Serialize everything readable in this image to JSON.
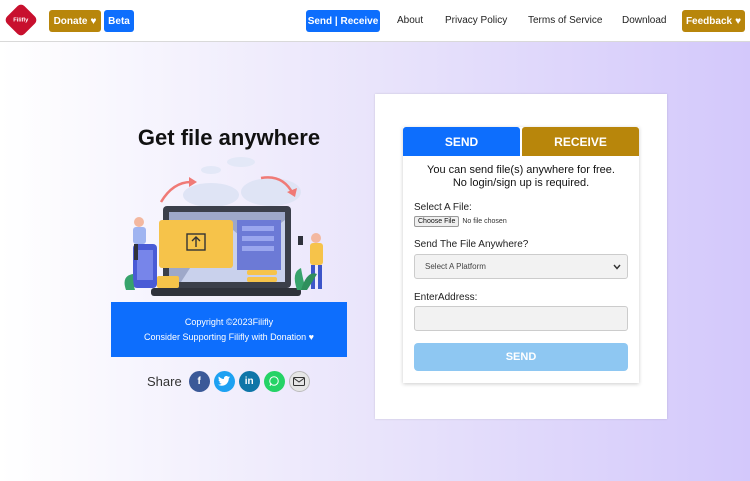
{
  "nav": {
    "logo_text": "Filifly",
    "donate_label": "Donate",
    "beta_label": "Beta",
    "send_receive_label": "Send | Receive",
    "links": [
      "About",
      "Privacy Policy",
      "Terms of Service",
      "Download"
    ],
    "feedback_label": "Feedback"
  },
  "hero": {
    "title": "Get file anywhere",
    "copyright": "Copyright ©2023Filifly",
    "support": "Consider Supporting Filifly with Donation ♥"
  },
  "share": {
    "label": "Share",
    "icons": [
      "facebook-icon",
      "twitter-icon",
      "linkedin-icon",
      "whatsapp-icon",
      "email-icon"
    ]
  },
  "form": {
    "tab_send": "SEND",
    "tab_receive": "RECEIVE",
    "intro_line1": "You can send file(s) anywhere for free.",
    "intro_line2": "No login/sign up is required.",
    "file_label": "Select A File:",
    "file_button": "Choose File",
    "file_status": "No file chosen",
    "platform_label": "Send The File Anywhere?",
    "platform_value": "Select A Platform",
    "address_label": "EnterAddress:",
    "address_value": "",
    "send_button": "SEND"
  },
  "colors": {
    "primary": "#0d6efd",
    "gold": "#b8860b",
    "send_disabled": "#8ec7f2",
    "logo_red": "#c8102e"
  }
}
